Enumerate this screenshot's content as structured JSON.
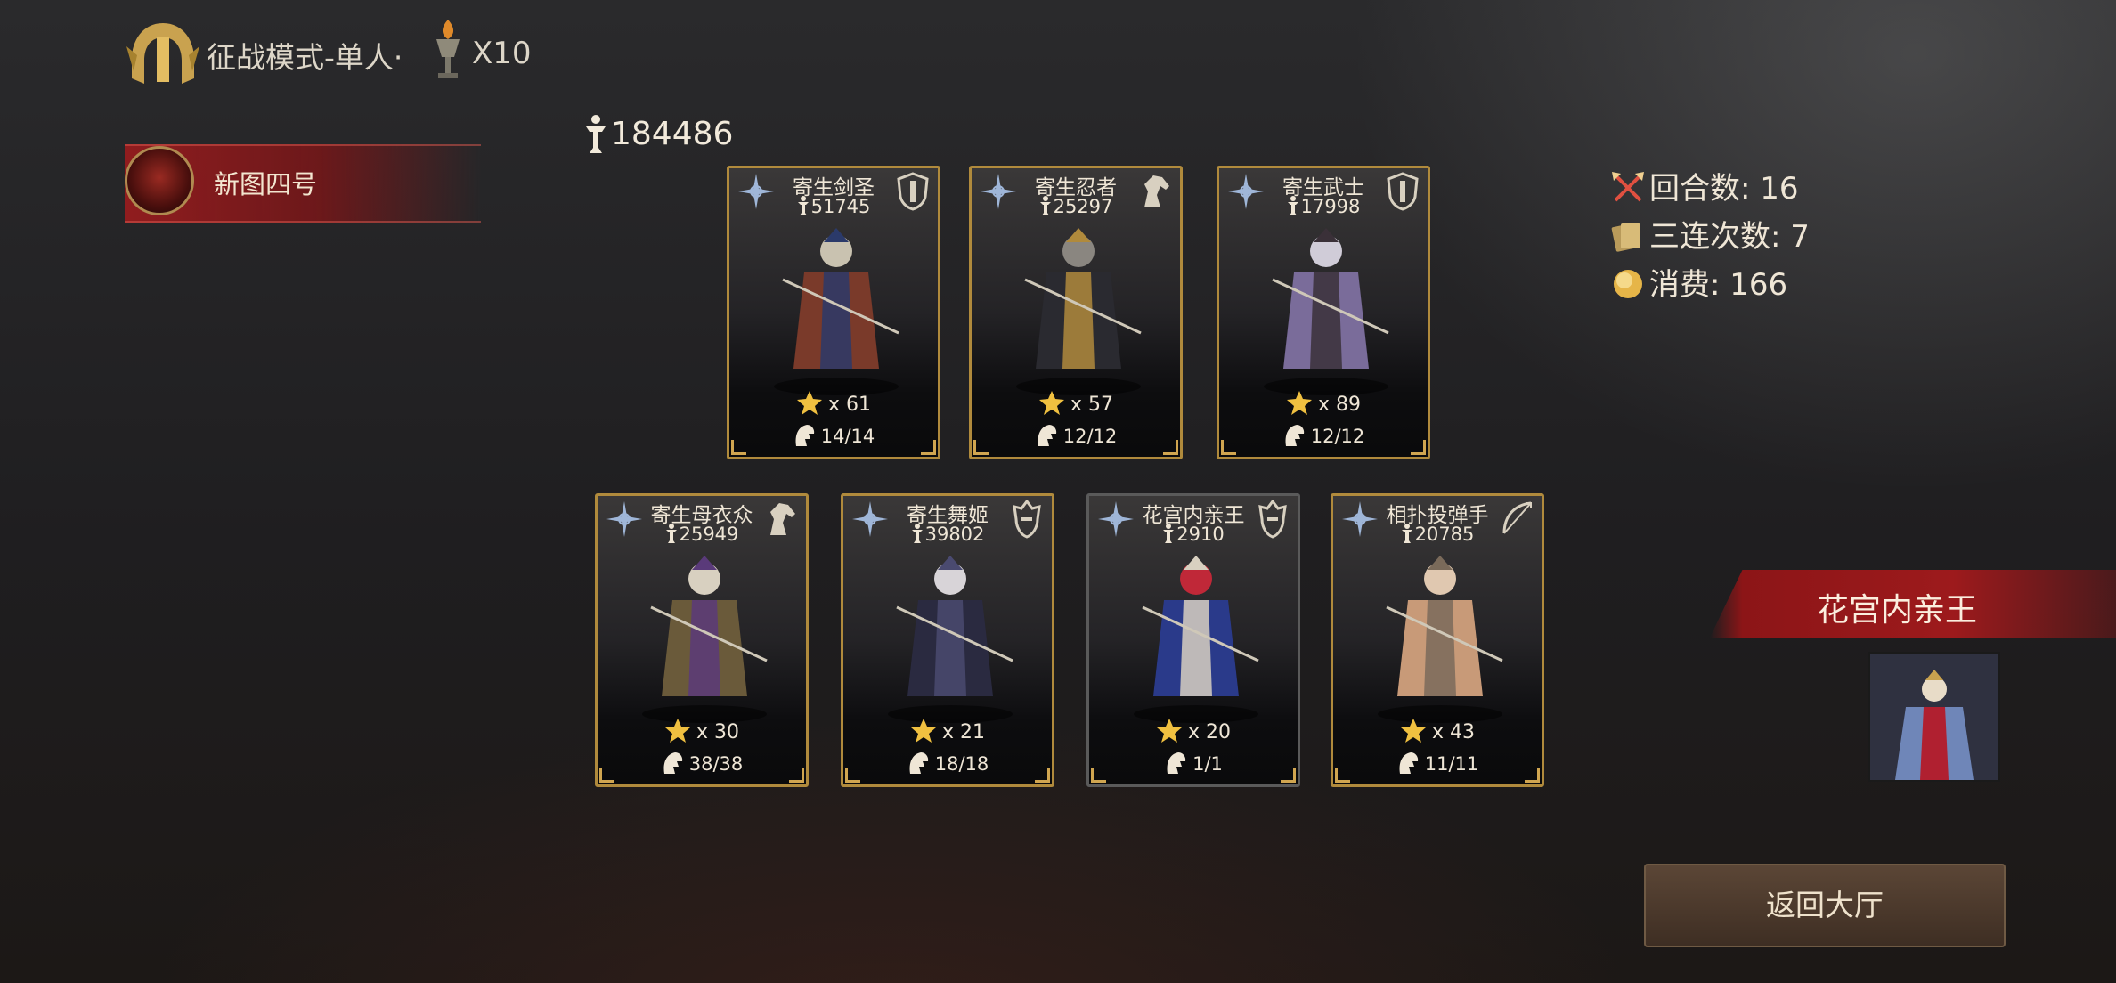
{
  "header": {
    "mode_title": "征战模式-单人·",
    "torch_count": "X10",
    "mode_icon": "golden-helmet-icon",
    "torch_icon": "torch-goblet-icon"
  },
  "map": {
    "name": "新图四号",
    "avatar_icon": "red-demon-mask-icon"
  },
  "total_power": "184486",
  "cards": [
    {
      "name": "寄生剑圣",
      "power": "51745",
      "stars": "x 61",
      "count": "14/14",
      "type_icon": "shield-icon",
      "frame": "gold"
    },
    {
      "name": "寄生忍者",
      "power": "25297",
      "stars": "x 57",
      "count": "12/12",
      "type_icon": "horse-icon",
      "frame": "gold"
    },
    {
      "name": "寄生武士",
      "power": "17998",
      "stars": "x 89",
      "count": "12/12",
      "type_icon": "shield-icon",
      "frame": "gold"
    },
    {
      "name": "寄生母衣众",
      "power": "25949",
      "stars": "x 30",
      "count": "38/38",
      "type_icon": "horse-icon",
      "frame": "gold"
    },
    {
      "name": "寄生舞姬",
      "power": "39802",
      "stars": "x 21",
      "count": "18/18",
      "type_icon": "helmet-icon",
      "frame": "gold"
    },
    {
      "name": "花宫内亲王",
      "power": "2910",
      "stars": "x 20",
      "count": "1/1",
      "type_icon": "helmet-icon",
      "frame": "grey"
    },
    {
      "name": "相扑投弹手",
      "power": "20785",
      "stars": "x 43",
      "count": "11/11",
      "type_icon": "bow-icon",
      "frame": "gold"
    }
  ],
  "stats": {
    "rounds": "回合数: 16",
    "triples": "三连次数: 7",
    "cost": "消费: 166"
  },
  "boss": {
    "name": "花宫内亲王"
  },
  "buttons": {
    "return": "返回大厅"
  },
  "colors": {
    "gold": "#b08a3c",
    "banner_red": "#9d1a1c",
    "button_brown": "#4a382b"
  }
}
